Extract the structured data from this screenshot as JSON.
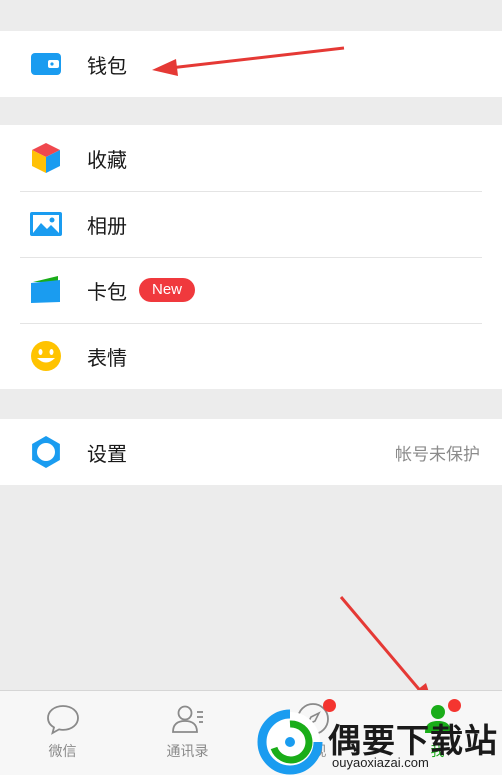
{
  "menu": {
    "wallet": "钱包",
    "favorites": "收藏",
    "album": "相册",
    "cards": "卡包",
    "cards_badge": "New",
    "stickers": "表情",
    "settings": "设置",
    "settings_status": "帐号未保护"
  },
  "tabbar": {
    "tabs": [
      {
        "label": "微信",
        "icon": "chat-bubble-icon"
      },
      {
        "label": "通讯录",
        "icon": "contacts-icon"
      },
      {
        "label": "发现",
        "icon": "compass-icon"
      },
      {
        "label": "我",
        "icon": "me-icon"
      }
    ],
    "active_color": "#1aad19"
  },
  "watermark": {
    "title": "偶要下载站",
    "url": "ouyaoxiazai.com"
  },
  "colors": {
    "accent_blue": "#1a9cf0",
    "badge_red": "#f0393d",
    "arrow_red": "#e53935"
  }
}
